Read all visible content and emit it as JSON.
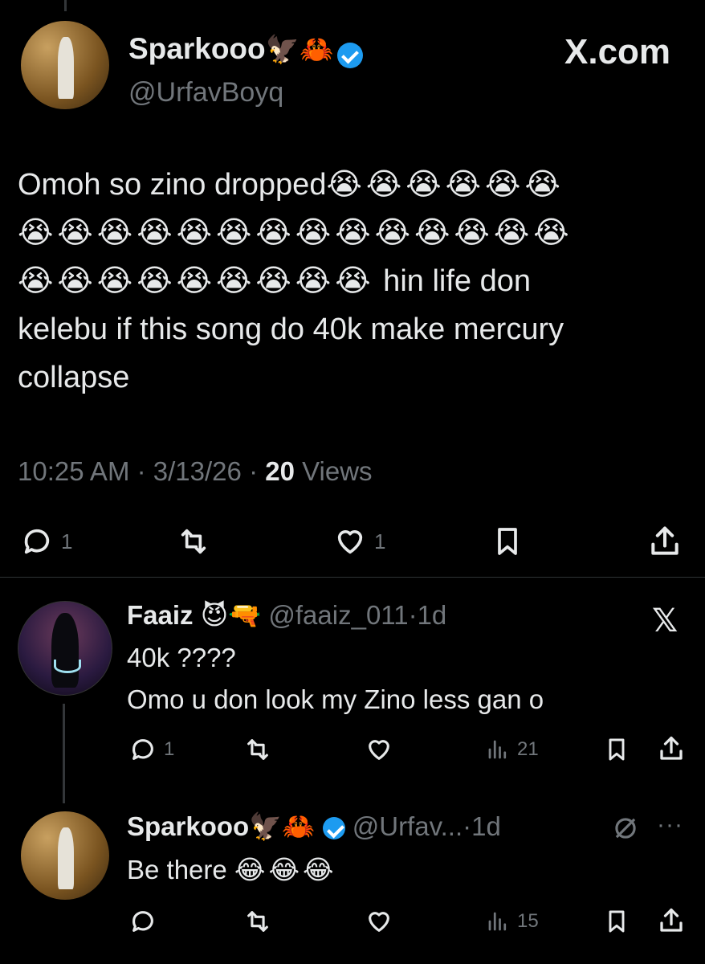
{
  "main_tweet": {
    "author_name": "Sparkooo",
    "author_emojis": "🦅🦀",
    "author_handle": "@UrfavBoyq",
    "watermark": "X.com",
    "text_line1": "Omoh so zino dropped",
    "emoji_line1": "😭😭😭😭😭😭",
    "emoji_line2": "😭😭😭😭😭😭😭😭😭😭😭😭😭😭",
    "emoji_line3": "😭😭😭😭😭😭😭😭😭",
    "text_line3_tail": " hin life don",
    "text_line4": "kelebu if this song do 40k make mercury",
    "text_line5": "collapse",
    "time": "10:25 AM",
    "date": "3/13/26",
    "views_count": "20",
    "views_label": "Views",
    "reply_count": "1",
    "like_count": "1"
  },
  "reply1": {
    "author_name": "Faaiz",
    "author_emojis": "😈🔫",
    "author_handle": "@faaiz_011",
    "age": "1d",
    "text_line1": "40k ????",
    "text_line2": "Omo u don look my Zino less gan o",
    "reply_count": "1",
    "views_count": "21"
  },
  "reply2": {
    "author_name": "Sparkooo",
    "author_emojis": "🦅🦀",
    "author_handle": "@Urfav...",
    "age": "1d",
    "text": "Be there",
    "text_emojis": "😂😂😂",
    "views_count": "15"
  },
  "separator": "·",
  "colors": {
    "background": "#000000",
    "text": "#e7e9ea",
    "muted": "#71767b",
    "verified": "#1d9bf0"
  }
}
